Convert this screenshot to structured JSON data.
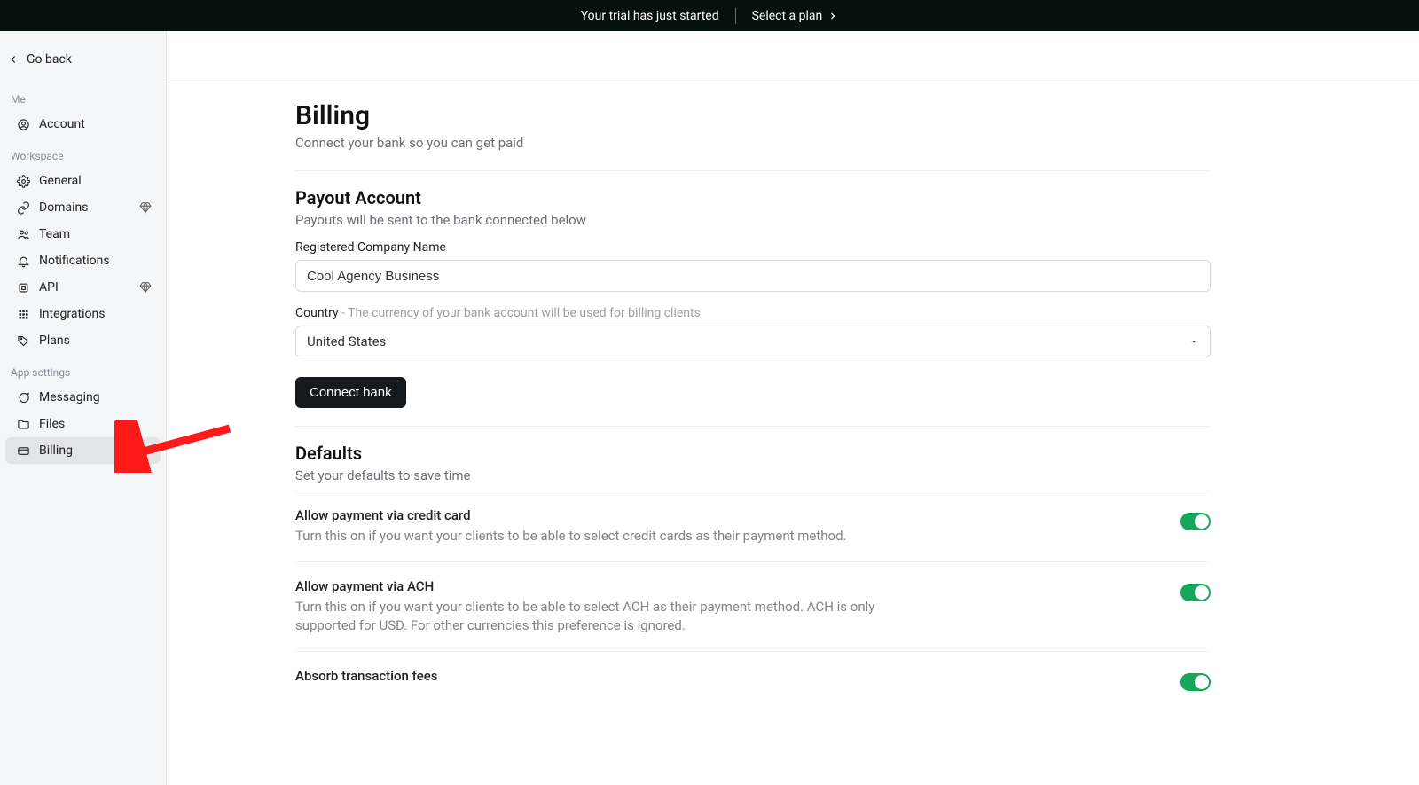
{
  "banner": {
    "trial_text": "Your trial has just started",
    "select_plan": "Select a plan"
  },
  "sidebar": {
    "go_back": "Go back",
    "sections": {
      "me": {
        "label": "Me",
        "items": [
          {
            "label": "Account"
          }
        ]
      },
      "workspace": {
        "label": "Workspace",
        "items": [
          {
            "label": "General"
          },
          {
            "label": "Domains",
            "premium": true
          },
          {
            "label": "Team"
          },
          {
            "label": "Notifications"
          },
          {
            "label": "API",
            "premium": true
          },
          {
            "label": "Integrations"
          },
          {
            "label": "Plans"
          }
        ]
      },
      "app": {
        "label": "App settings",
        "items": [
          {
            "label": "Messaging"
          },
          {
            "label": "Files"
          },
          {
            "label": "Billing",
            "active": true
          }
        ]
      }
    }
  },
  "page": {
    "title": "Billing",
    "subtitle": "Connect your bank so you can get paid"
  },
  "payout": {
    "heading": "Payout Account",
    "sub": "Payouts will be sent to the bank connected below",
    "company_label": "Registered Company Name",
    "company_value": "Cool Agency Business",
    "country_label": "Country",
    "country_hint": " - The currency of your bank account will be used for billing clients",
    "country_value": "United States",
    "connect_button": "Connect bank"
  },
  "defaults": {
    "heading": "Defaults",
    "sub": "Set your defaults to save time",
    "rows": [
      {
        "title": "Allow payment via credit card",
        "desc": "Turn this on if you want your clients to be able to select credit cards as their payment method.",
        "on": true
      },
      {
        "title": "Allow payment via ACH",
        "desc": "Turn this on if you want your clients to be able to select ACH as their payment method. ACH is only supported for USD. For other currencies this preference is ignored.",
        "on": true
      },
      {
        "title": "Absorb transaction fees",
        "desc": "",
        "on": true
      }
    ]
  }
}
